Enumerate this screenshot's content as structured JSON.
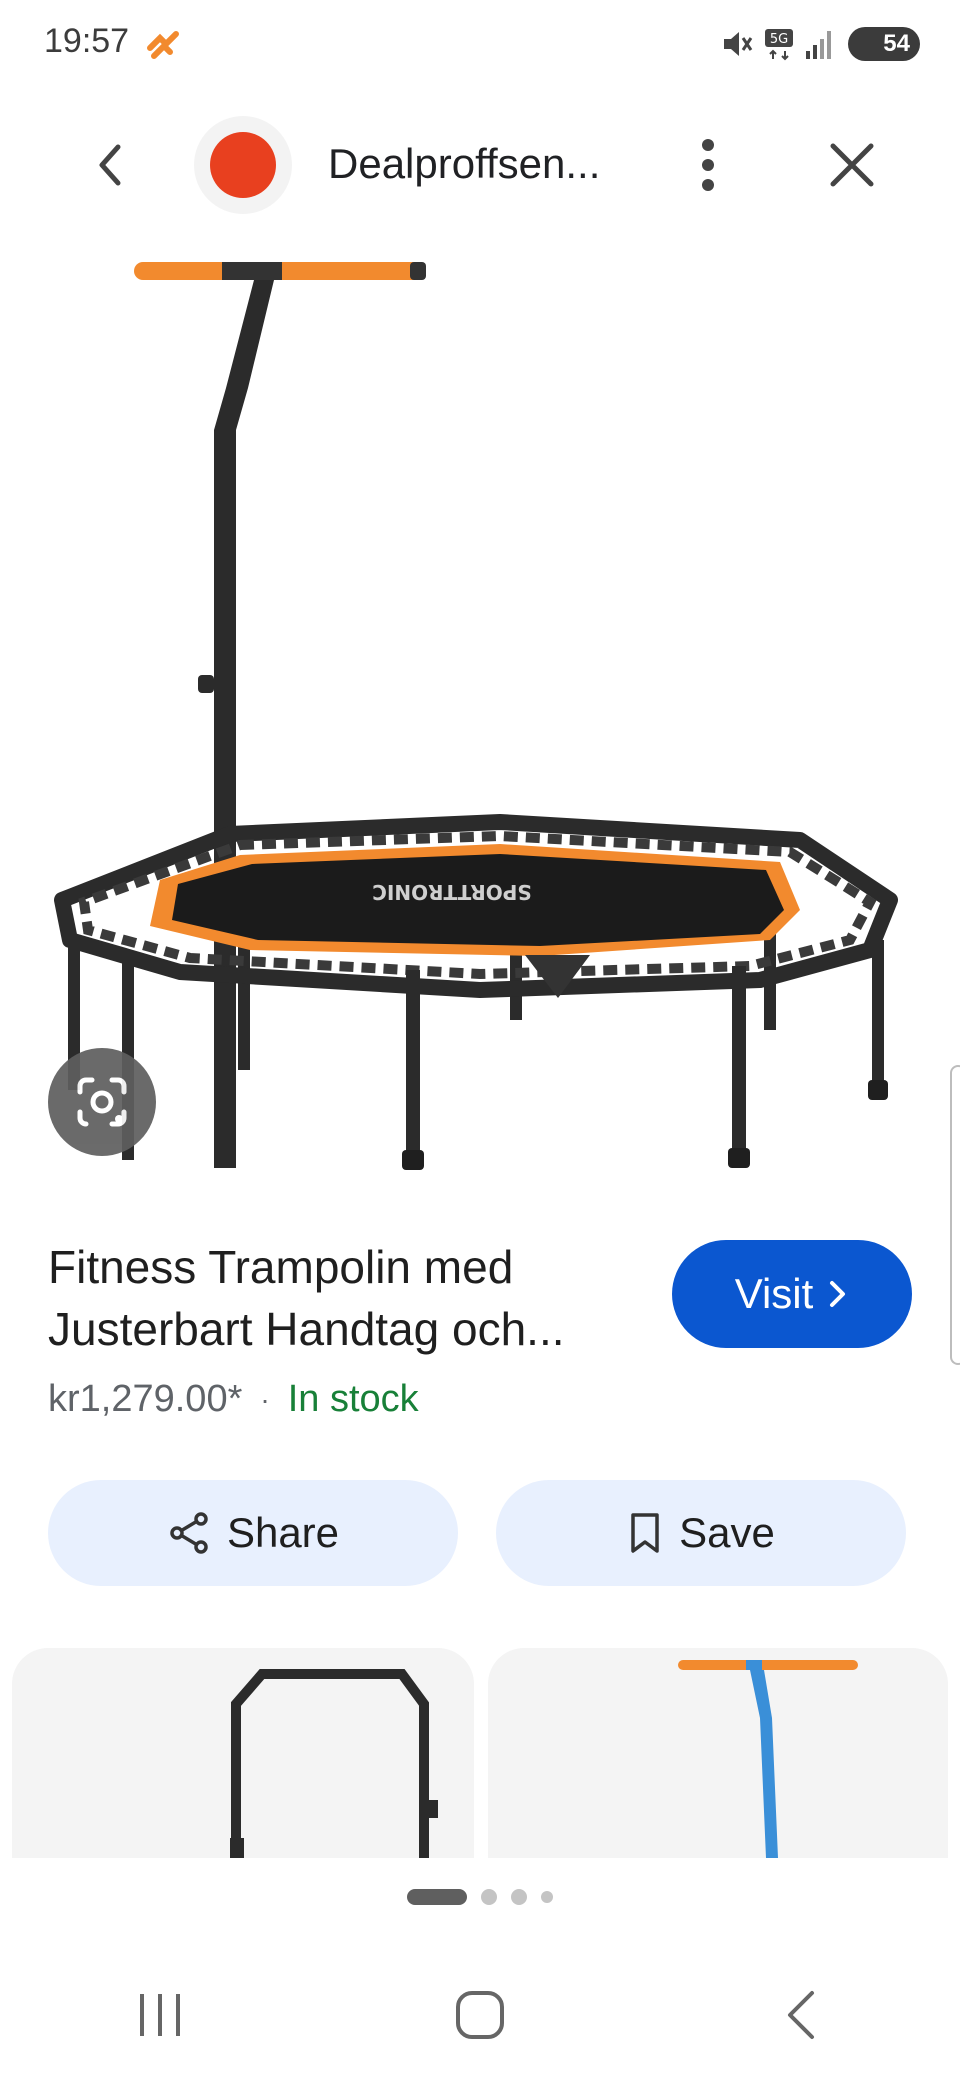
{
  "status_bar": {
    "time": "19:57",
    "battery": "54"
  },
  "header": {
    "site_name": "Dealproffsen..."
  },
  "product": {
    "title_line1": "Fitness Trampolin med",
    "title_line2": "Justerbart Handtag och...",
    "price": "kr1,279.00*",
    "separator": "·",
    "availability": "In stock",
    "brand_print": "SPORTTRONIC"
  },
  "actions": {
    "visit_label": "Visit",
    "share_label": "Share",
    "save_label": "Save"
  },
  "pagination": {
    "count": 4,
    "active_index": 0
  },
  "colors": {
    "accent_blue": "#0b57d0",
    "pill_bg": "#e8f0fe",
    "in_stock_green": "#188038",
    "trampoline_orange": "#f28a2e",
    "logo_red": "#e8401f"
  },
  "icons": [
    "back-icon",
    "more-vert-icon",
    "close-icon",
    "google-lens-icon",
    "share-icon",
    "bookmark-icon",
    "chevron-right-icon",
    "recents-icon",
    "home-icon",
    "nav-back-icon"
  ]
}
